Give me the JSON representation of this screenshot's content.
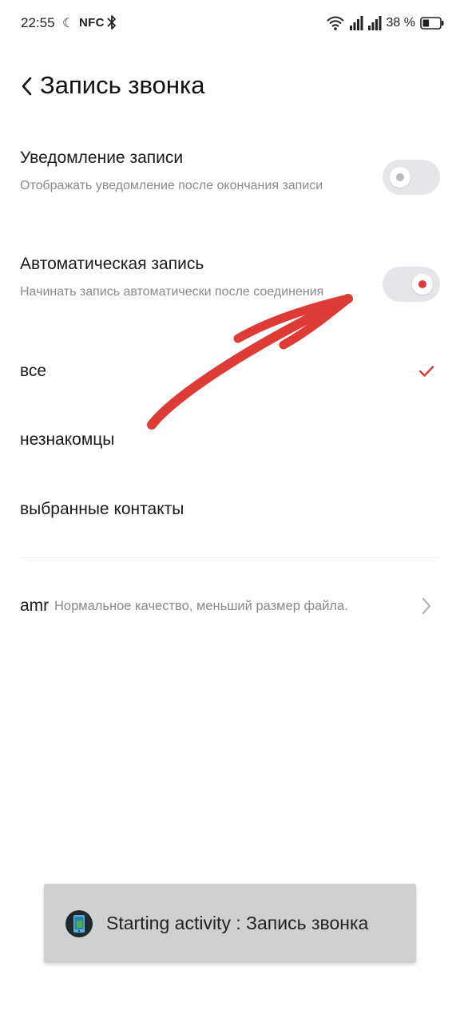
{
  "status_bar": {
    "time": "22:55",
    "nfc": "NFC",
    "battery_text": "38 %",
    "icons": [
      "moon-icon",
      "bluetooth-icon",
      "wifi-icon",
      "signal-icon",
      "signal-icon",
      "battery-icon"
    ],
    "battery_level": 0.38
  },
  "header": {
    "title": "Запись звонка",
    "back_icon": "chevron-left-icon"
  },
  "settings": {
    "notification": {
      "title": "Уведомление записи",
      "subtitle": "Отображать уведомление после окончания записи",
      "enabled": false
    },
    "auto_record": {
      "title": "Автоматическая запись",
      "subtitle": "Начинать запись автоматически после соединения",
      "enabled": true
    },
    "choices": [
      {
        "label": "все",
        "selected": true
      },
      {
        "label": "незнакомцы",
        "selected": false
      },
      {
        "label": "выбранные контакты",
        "selected": false
      }
    ],
    "format": {
      "name": "amr",
      "description": "Нормальное качество, меньший размер файла."
    }
  },
  "toast": {
    "text": "Starting activity : Запись звонка",
    "icon": "phone-app-icon"
  },
  "colors": {
    "accent": "#e0363a",
    "annotation_arrow": "#dd3b35",
    "toggle_track": "#e6e6ea",
    "secondary_text": "#8a8a8a",
    "toast_bg": "#d0d0d0"
  }
}
